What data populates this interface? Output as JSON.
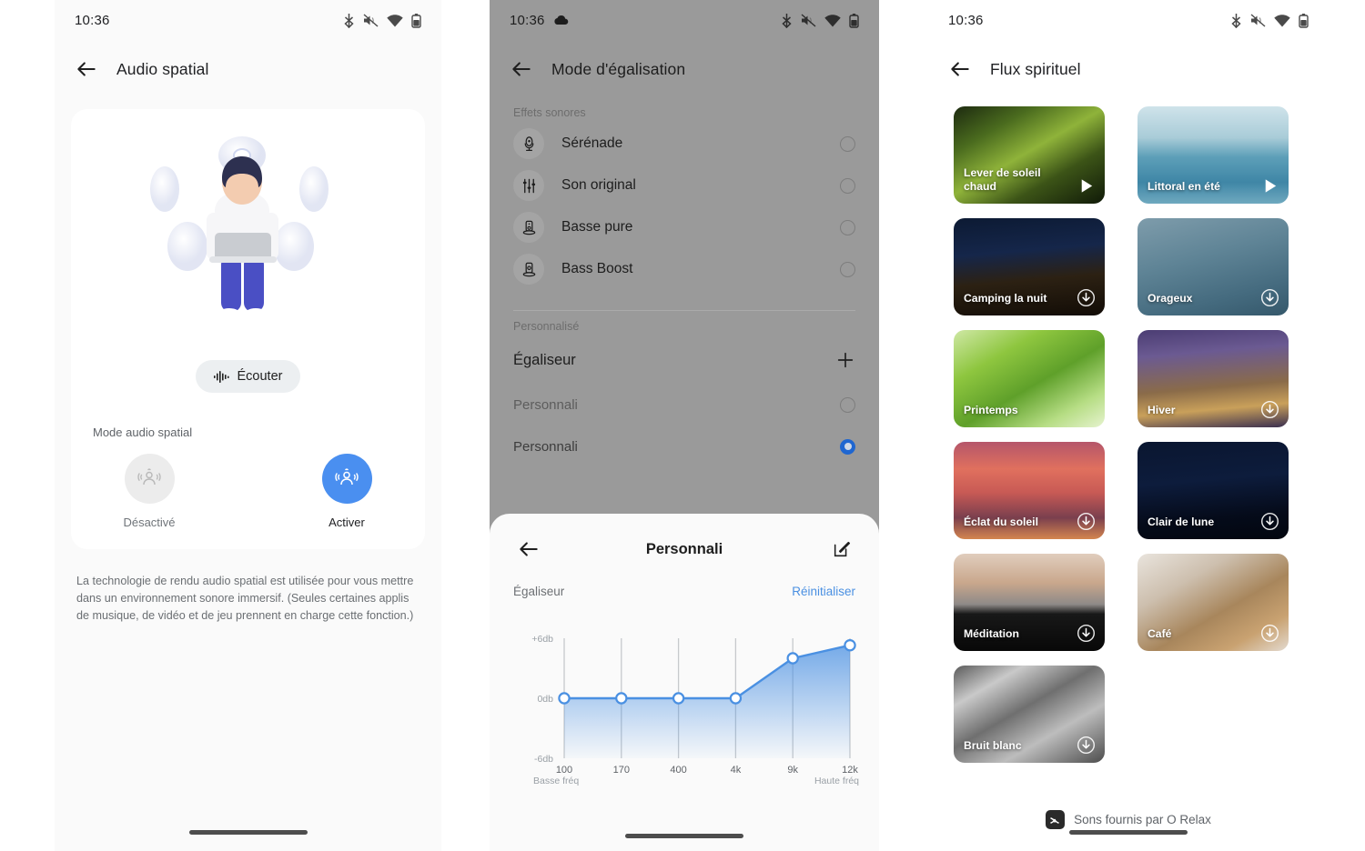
{
  "accent": {
    "blue": "#4a8ff0",
    "link": "#4a90e2",
    "radio_selected": "#1f66d0"
  },
  "panel1": {
    "statusbar": {
      "time": "10:36",
      "icons": [
        "bluetooth-icon",
        "mute-icon",
        "wifi-icon",
        "battery-icon"
      ]
    },
    "appbar": {
      "back": "back-arrow-icon",
      "title": "Audio spatial"
    },
    "listen_button": {
      "label": "Écouter",
      "icon": "waveform-icon"
    },
    "mode_label": "Mode audio spatial",
    "modes": [
      {
        "id": "off",
        "label": "Désactivé",
        "selected": false
      },
      {
        "id": "on",
        "label": "Activer",
        "selected": true
      }
    ],
    "description": "La technologie de rendu audio spatial est utilisée pour vous mettre dans un environnement sonore immersif. (Seules certaines applis de musique, de vidéo et de jeu prennent en charge cette fonction.)"
  },
  "panel2": {
    "statusbar": {
      "time": "10:36",
      "cloud": "☁",
      "icons": [
        "bluetooth-icon",
        "mute-icon",
        "wifi-icon",
        "battery-icon"
      ]
    },
    "appbar": {
      "back": "back-arrow-icon",
      "title": "Mode d'égalisation"
    },
    "section_effects": "Effets sonores",
    "effects": [
      {
        "label": "Sérénade",
        "icon": "microphone-icon",
        "selected": false
      },
      {
        "label": "Son original",
        "icon": "sliders-icon",
        "selected": false
      },
      {
        "label": "Basse pure",
        "icon": "speaker-icon",
        "selected": false
      },
      {
        "label": "Bass Boost",
        "icon": "speaker-icon",
        "selected": false
      }
    ],
    "section_custom": "Personnalisé",
    "equalizer_header": {
      "title": "Égaliseur",
      "add_icon": "plus-icon"
    },
    "custom_presets": [
      {
        "label": "Personnali",
        "selected": false
      },
      {
        "label": "Personnali",
        "selected": true
      }
    ],
    "sheet": {
      "back": "back-arrow-icon",
      "title": "Personnali",
      "edit_icon": "edit-icon",
      "subtitle_left": "Égaliseur",
      "reset_label": "Réinitialiser"
    }
  },
  "chart_data": {
    "type": "line",
    "title": "Égaliseur",
    "x": [
      "100",
      "170",
      "400",
      "4k",
      "9k",
      "12k"
    ],
    "values": [
      0,
      0,
      0,
      0,
      4,
      5.3
    ],
    "ylabel": "",
    "xlabel": "",
    "ytick_labels": [
      "+6db",
      "0db",
      "-6db"
    ],
    "ytick_values": [
      6,
      0,
      -6
    ],
    "ylim": [
      -6,
      6
    ],
    "axis_end_labels": {
      "left": "Basse fréq",
      "right": "Haute fréq"
    },
    "grid": true,
    "legend": "none",
    "series": [
      {
        "name": "Personnali",
        "values": [
          0,
          0,
          0,
          0,
          4,
          5.3
        ]
      }
    ]
  },
  "panel3": {
    "statusbar": {
      "time": "10:36",
      "icons": [
        "bluetooth-icon",
        "mute-icon",
        "wifi-icon",
        "battery-icon"
      ]
    },
    "appbar": {
      "back": "back-arrow-icon",
      "title": "Flux spirituel"
    },
    "tiles": [
      {
        "label": "Lever de soleil chaud",
        "action": "play",
        "theme": "forest"
      },
      {
        "label": "Littoral en été",
        "action": "play",
        "theme": "sea"
      },
      {
        "label": "Camping la nuit",
        "action": "download",
        "theme": "camp"
      },
      {
        "label": "Orageux",
        "action": "download",
        "theme": "rain"
      },
      {
        "label": "Printemps",
        "action": "none",
        "theme": "spring"
      },
      {
        "label": "Hiver",
        "action": "download",
        "theme": "winter"
      },
      {
        "label": "Éclat du soleil",
        "action": "download",
        "theme": "sunset"
      },
      {
        "label": "Clair de lune",
        "action": "download",
        "theme": "moon"
      },
      {
        "label": "Méditation",
        "action": "download",
        "theme": "meditate"
      },
      {
        "label": "Café",
        "action": "download",
        "theme": "coffee"
      },
      {
        "label": "Bruit blanc",
        "action": "download",
        "theme": "noise"
      }
    ],
    "footer": {
      "logo": "orelax-logo-icon",
      "text": "Sons fournis par O Relax"
    }
  }
}
